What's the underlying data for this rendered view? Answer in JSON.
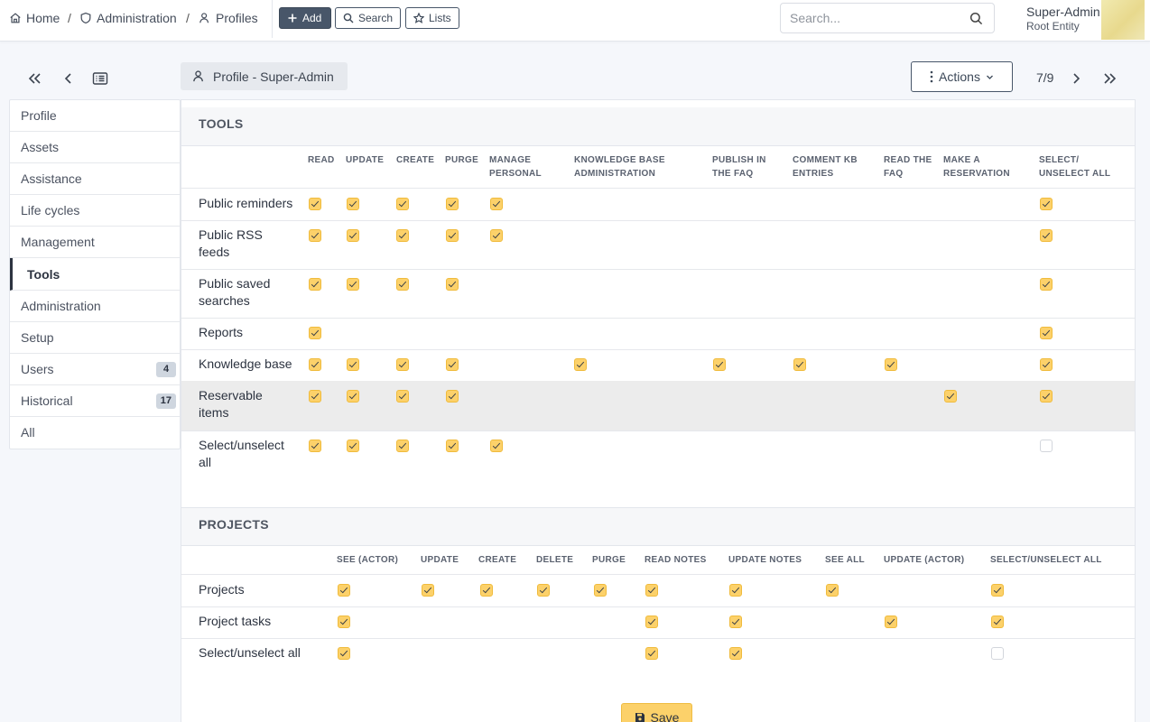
{
  "breadcrumb": {
    "home": "Home",
    "administration": "Administration",
    "profiles": "Profiles",
    "separator": "/"
  },
  "toolbar": {
    "add": "Add",
    "search": "Search",
    "lists": "Lists"
  },
  "search_bar": {
    "placeholder": "Search..."
  },
  "user": {
    "name": "Super-Admin",
    "entity": "Root Entity"
  },
  "header": {
    "profile_tab": "Profile - Super-Admin",
    "actions": "Actions",
    "pager": "7/9"
  },
  "sidebar": {
    "items": [
      {
        "label": "Profile"
      },
      {
        "label": "Assets"
      },
      {
        "label": "Assistance"
      },
      {
        "label": "Life cycles"
      },
      {
        "label": "Management"
      },
      {
        "label": "Tools",
        "active": true
      },
      {
        "label": "Administration"
      },
      {
        "label": "Setup"
      },
      {
        "label": "Users",
        "badge": "4"
      },
      {
        "label": "Historical",
        "badge": "17"
      },
      {
        "label": "All"
      }
    ]
  },
  "tools": {
    "title": "TOOLS",
    "columns": [
      "READ",
      "UPDATE",
      "CREATE",
      "PURGE",
      "MANAGE\nPERSONAL",
      "KNOWLEDGE BASE\nADMINISTRATION",
      "PUBLISH IN\nTHE FAQ",
      "COMMENT KB\nENTRIES",
      "READ THE\nFAQ",
      "MAKE A\nRESERVATION",
      "SELECT/\nUNSELECT ALL"
    ],
    "rows": [
      {
        "label": "Public reminders",
        "checks": [
          1,
          1,
          1,
          1,
          1,
          null,
          null,
          null,
          null,
          null,
          1
        ]
      },
      {
        "label": "Public RSS\nfeeds",
        "checks": [
          1,
          1,
          1,
          1,
          1,
          null,
          null,
          null,
          null,
          null,
          1
        ]
      },
      {
        "label": "Public saved\nsearches",
        "checks": [
          1,
          1,
          1,
          1,
          null,
          null,
          null,
          null,
          null,
          null,
          1
        ]
      },
      {
        "label": "Reports",
        "checks": [
          1,
          null,
          null,
          null,
          null,
          null,
          null,
          null,
          null,
          null,
          1
        ]
      },
      {
        "label": "Knowledge base",
        "checks": [
          1,
          1,
          1,
          1,
          null,
          1,
          1,
          1,
          1,
          null,
          1
        ]
      },
      {
        "label": "Reservable\nitems",
        "checks": [
          1,
          1,
          1,
          1,
          null,
          null,
          null,
          null,
          null,
          1,
          1
        ]
      },
      {
        "label": "Select/unselect\nall",
        "checks": [
          1,
          1,
          1,
          1,
          1,
          null,
          null,
          null,
          null,
          null,
          0
        ]
      }
    ]
  },
  "projects": {
    "title": "PROJECTS",
    "columns": [
      "SEE (ACTOR)",
      "UPDATE",
      "CREATE",
      "DELETE",
      "PURGE",
      "READ NOTES",
      "UPDATE NOTES",
      "SEE ALL",
      "UPDATE (ACTOR)",
      "SELECT/UNSELECT ALL"
    ],
    "rows": [
      {
        "label": "Projects",
        "checks": [
          1,
          1,
          1,
          1,
          1,
          1,
          1,
          1,
          null,
          1
        ]
      },
      {
        "label": "Project tasks",
        "checks": [
          1,
          null,
          null,
          null,
          null,
          1,
          1,
          null,
          1,
          1
        ]
      },
      {
        "label": "Select/unselect all",
        "checks": [
          1,
          null,
          null,
          null,
          null,
          1,
          1,
          null,
          null,
          0
        ]
      }
    ]
  },
  "footer": {
    "save": "Save"
  },
  "colors": {
    "accent": "#fcd16a",
    "dark_button": "#485669"
  }
}
